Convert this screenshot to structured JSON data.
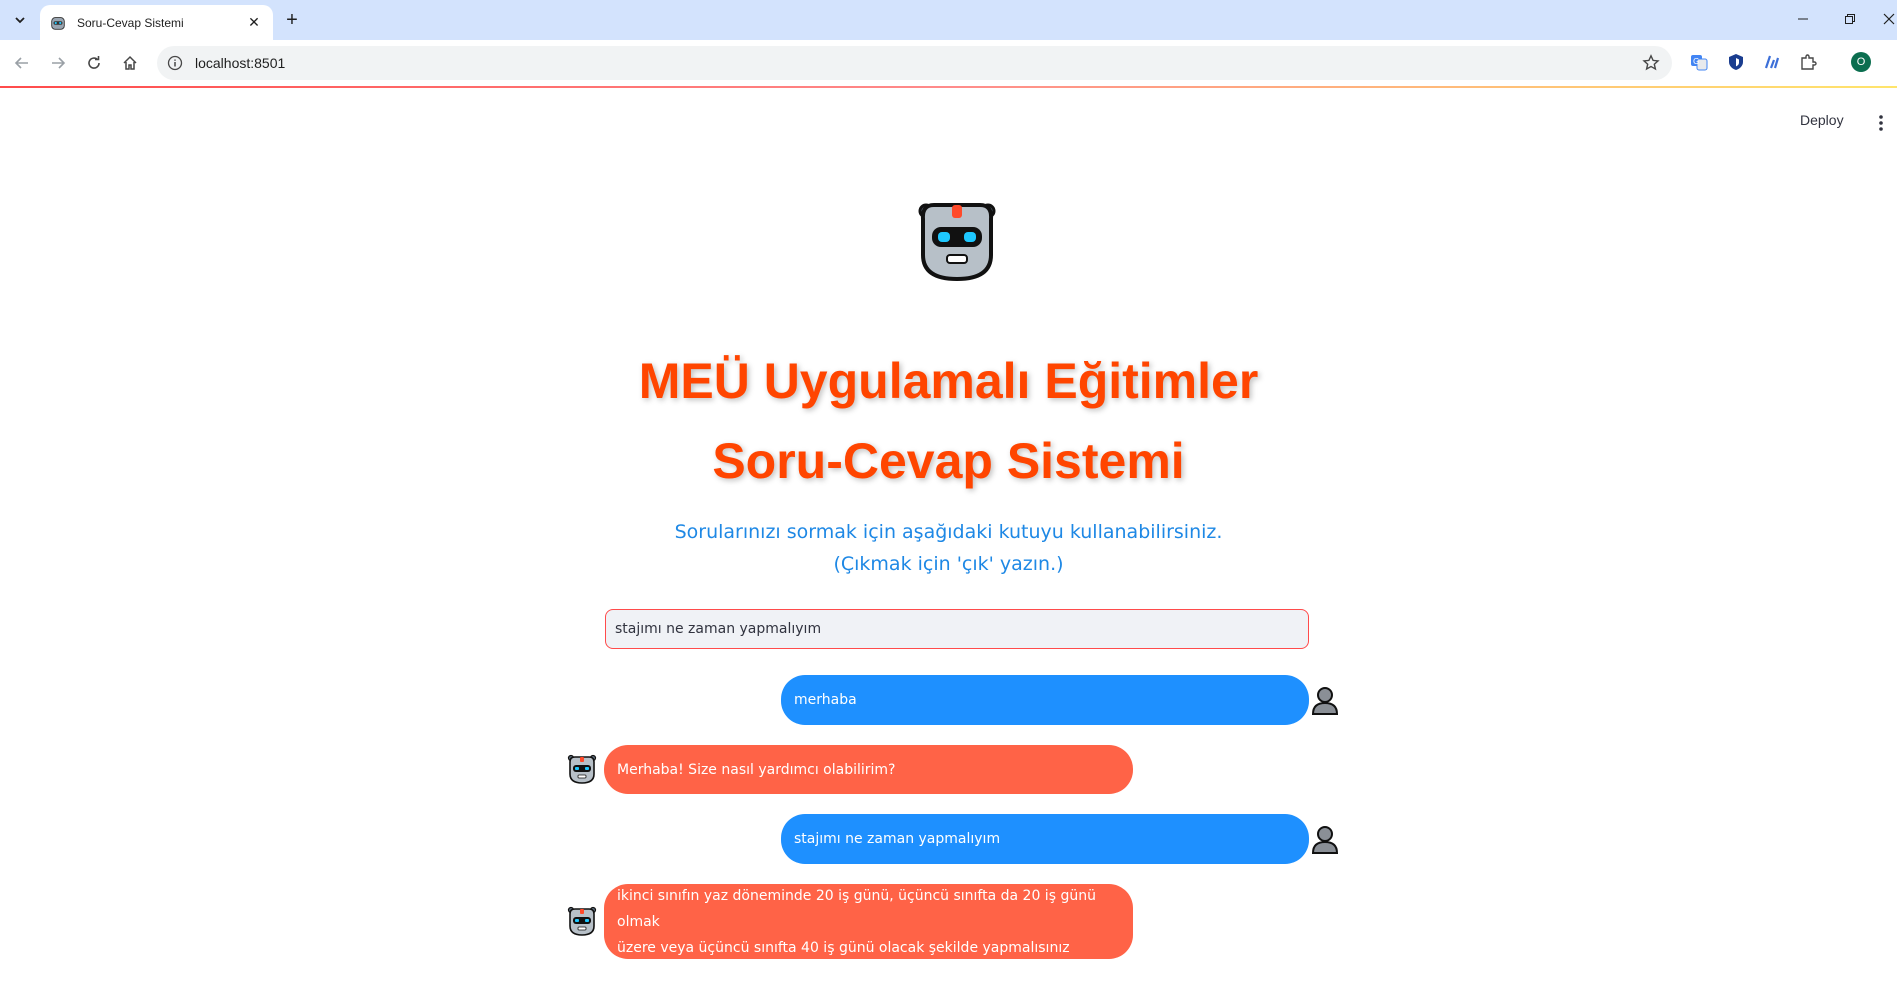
{
  "browser": {
    "tab_title": "Soru-Cevap Sistemi",
    "url": "localhost:8501",
    "profile_initial": "O",
    "accent_color": "#d3e3fd"
  },
  "app": {
    "deploy_label": "Deploy",
    "title_line1": "MEÜ Uygulamalı Eğitimler",
    "title_line2": "Soru-Cevap Sistemi",
    "subtitle_line1": "Sorularınızı sormak için aşağıdaki kutuyu kullanabilirsiniz.",
    "subtitle_line2": "(Çıkmak için 'çık' yazın.)",
    "question_value": "stajımı ne zaman yapmalıyım",
    "title_color": "#ff4500",
    "subtitle_color": "#1e88e5",
    "user_bubble_color": "#1e90ff",
    "bot_bubble_color": "#ff6347"
  },
  "messages": [
    {
      "role": "user",
      "text": "merhaba"
    },
    {
      "role": "bot",
      "text": "Merhaba! Size nasıl yardımcı olabilirim?"
    },
    {
      "role": "user",
      "text": "stajımı ne zaman yapmalıyım"
    },
    {
      "role": "bot",
      "text_line1": "ikinci sınıfın yaz döneminde 20 iş günü, üçüncü sınıfta da 20 iş günü olmak",
      "text_line2": "üzere veya üçüncü sınıfta 40 iş günü olacak şekilde yapmalısınız"
    }
  ]
}
